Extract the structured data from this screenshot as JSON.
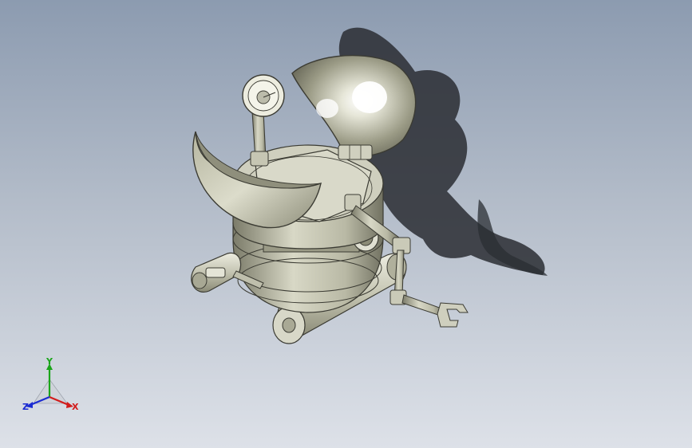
{
  "viewport": {
    "background_top": "#8c9bb0",
    "background_bottom": "#dde1e8"
  },
  "model": {
    "name": "robot-assembly",
    "body_color": "#c9c9b6",
    "shadow_color": "#2a2d33"
  },
  "triad": {
    "x_label": "X",
    "y_label": "Y",
    "z_label": "Z",
    "x_color": "#d21c1c",
    "y_color": "#1aa51a",
    "z_color": "#1c2cd2"
  }
}
